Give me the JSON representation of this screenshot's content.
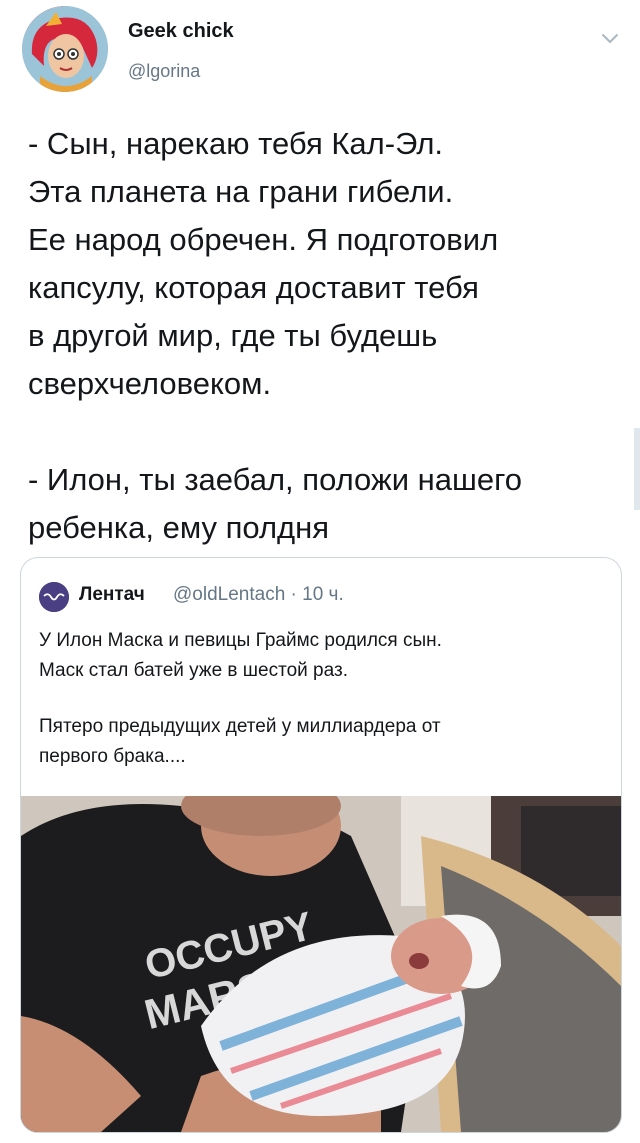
{
  "author": {
    "name": "Geek chick",
    "handle": "@lgorina"
  },
  "tweet": {
    "lines": [
      "- Сын, нарекаю тебя Кал-Эл.",
      "Эта планета на грани гибели.",
      "Ее народ обречен. Я подготовил",
      "капсулу, которая доставит тебя",
      "в другой мир, где ты будешь",
      "сверхчеловеком."
    ],
    "lines2": [
      "- Илон, ты заебал, положи нашего",
      "ребенка, ему полдня"
    ]
  },
  "quoted": {
    "author_name": "Лентач",
    "handle_time": "@oldLentach · 10 ч.",
    "text_lines": [
      "У Илон Маска и певицы Граймс родился сын.",
      "Маск стал батей уже в шестой раз."
    ],
    "text_lines2": [
      "Пятеро предыдущих детей у миллиардера от",
      "первого брака...."
    ],
    "photo": {
      "shirt_text_line1": "OCCUPY",
      "shirt_text_line2": "MARS"
    }
  },
  "icons": {
    "menu": "chevron-down-icon",
    "quoted_avatar": "lentach-logo-icon"
  },
  "colors": {
    "text": "#14171a",
    "secondary": "#657786",
    "border": "#ccd6dd"
  }
}
